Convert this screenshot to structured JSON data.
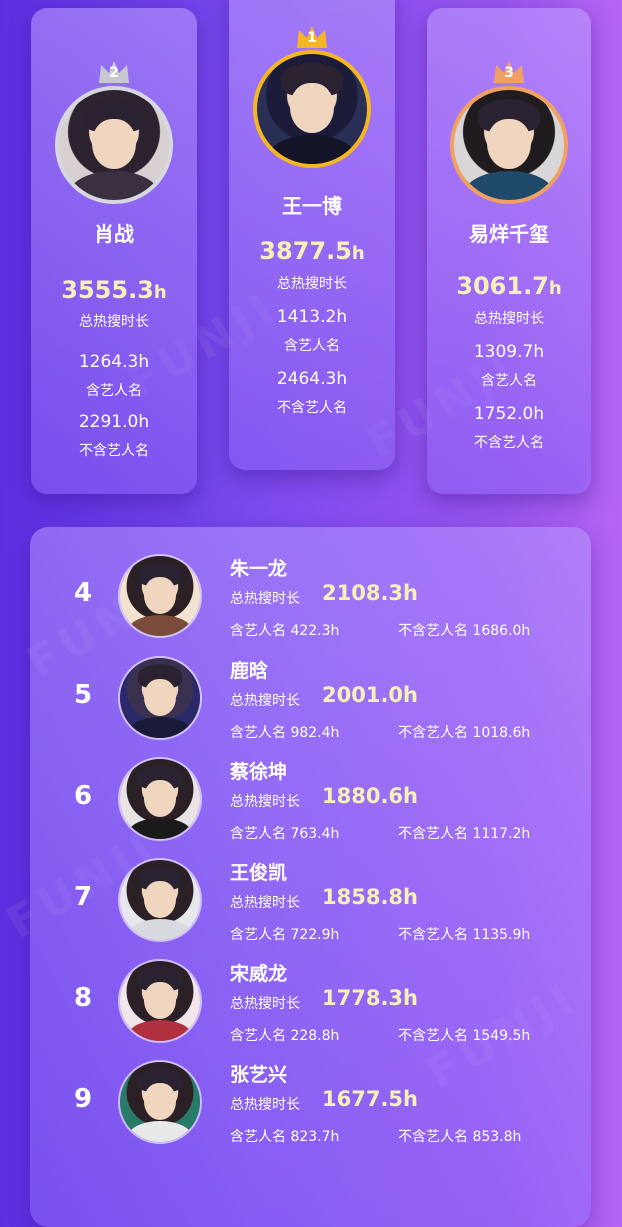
{
  "watermark": "FUNJI",
  "podium": [
    {
      "rank": "2",
      "name": "肖战",
      "total": "3555.3",
      "unit": "h",
      "total_label": "总热搜时长",
      "with_value": "1264.3h",
      "with_label": "含艺人名",
      "without_value": "2291.0h",
      "without_label": "不含艺人名",
      "crown_color": "#c8c8d2"
    },
    {
      "rank": "1",
      "name": "王一博",
      "total": "3877.5",
      "unit": "h",
      "total_label": "总热搜时长",
      "with_value": "1413.2h",
      "with_label": "含艺人名",
      "without_value": "2464.3h",
      "without_label": "不含艺人名",
      "crown_color": "#f5b623"
    },
    {
      "rank": "3",
      "name": "易烊千玺",
      "total": "3061.7",
      "unit": "h",
      "total_label": "总热搜时长",
      "with_value": "1309.7h",
      "with_label": "含艺人名",
      "without_value": "1752.0h",
      "without_label": "不含艺人名",
      "crown_color": "#f0a060"
    }
  ],
  "list": [
    {
      "rank": "4",
      "name": "朱一龙",
      "total_label": "总热搜时长",
      "total": "2108.3h",
      "with_text": "含艺人名 422.3h",
      "without_text": "不含艺人名 1686.0h"
    },
    {
      "rank": "5",
      "name": "鹿晗",
      "total_label": "总热搜时长",
      "total": "2001.0h",
      "with_text": "含艺人名 982.4h",
      "without_text": "不含艺人名 1018.6h"
    },
    {
      "rank": "6",
      "name": "蔡徐坤",
      "total_label": "总热搜时长",
      "total": "1880.6h",
      "with_text": "含艺人名 763.4h",
      "without_text": "不含艺人名 1117.2h"
    },
    {
      "rank": "7",
      "name": "王俊凯",
      "total_label": "总热搜时长",
      "total": "1858.8h",
      "with_text": "含艺人名 722.9h",
      "without_text": "不含艺人名 1135.9h"
    },
    {
      "rank": "8",
      "name": "宋威龙",
      "total_label": "总热搜时长",
      "total": "1778.3h",
      "with_text": "含艺人名 228.8h",
      "without_text": "不含艺人名 1549.5h"
    },
    {
      "rank": "9",
      "name": "张艺兴",
      "total_label": "总热搜时长",
      "total": "1677.5h",
      "with_text": "含艺人名 823.7h",
      "without_text": "不含艺人名 853.8h"
    }
  ]
}
